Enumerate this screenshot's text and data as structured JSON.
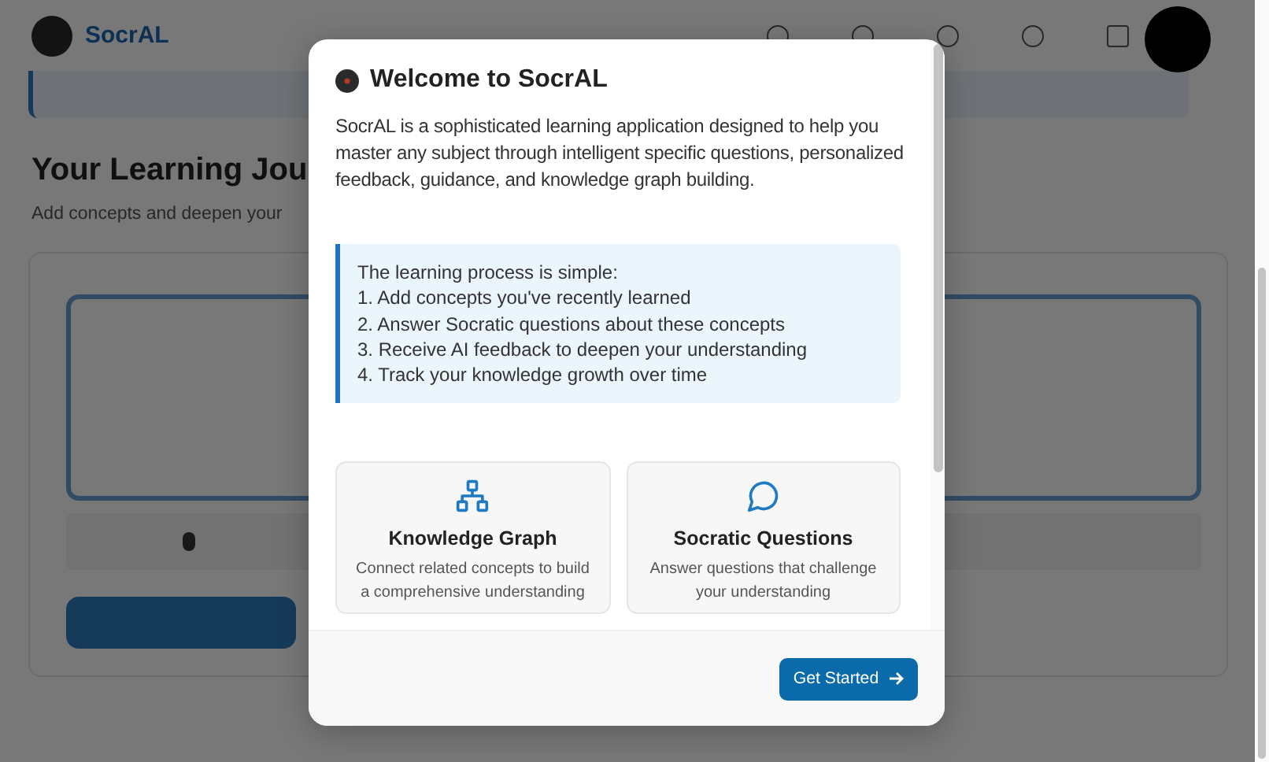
{
  "app": {
    "logo": "SocrAL"
  },
  "page": {
    "heading": "Your Learning Jou",
    "subheading": "Add concepts and deepen your"
  },
  "modal": {
    "title": "Welcome to SocrAL",
    "intro": "SocrAL is a sophisticated learning application designed to help you master any subject through intelligent specific questions, personalized feedback, guidance, and knowledge graph building.",
    "info": {
      "heading": "The learning process is simple:",
      "steps": [
        "1. Add concepts you've recently learned",
        "2. Answer Socratic questions about these concepts",
        "3. Receive AI feedback to deepen your understanding",
        "4. Track your knowledge growth over time"
      ]
    },
    "features": [
      {
        "kind": "graph",
        "title": "Knowledge Graph",
        "description": "Connect related concepts to build a comprehensive understanding"
      },
      {
        "kind": "chat",
        "title": "Socratic Questions",
        "description": "Answer questions that challenge your understanding"
      }
    ],
    "button": "Get Started"
  }
}
